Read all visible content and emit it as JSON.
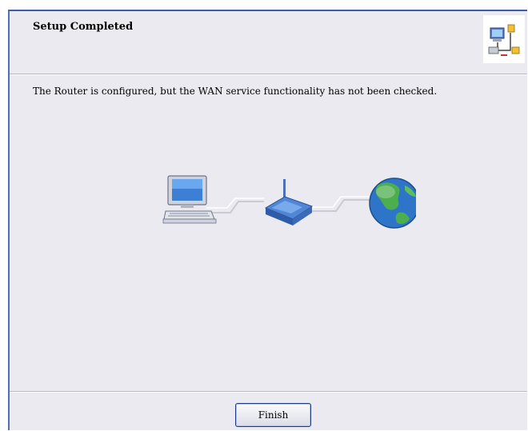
{
  "header": {
    "title": "Setup Completed",
    "icon": "network-setup-icon"
  },
  "main": {
    "message": "The Router is configured, but the WAN service functionality has not been checked.",
    "diagram": {
      "icons": [
        "computer-icon",
        "router-icon",
        "globe-icon"
      ]
    }
  },
  "footer": {
    "finish_label": "Finish"
  },
  "colors": {
    "dialog_background": "#eceaf1",
    "border_accent": "#3a5fb0"
  }
}
